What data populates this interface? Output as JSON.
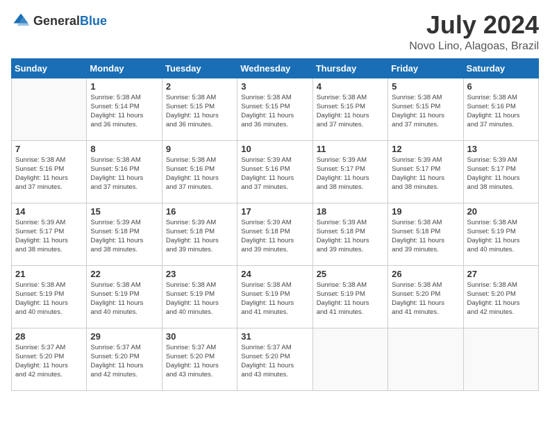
{
  "logo": {
    "general": "General",
    "blue": "Blue"
  },
  "title": "July 2024",
  "location": "Novo Lino, Alagoas, Brazil",
  "weekdays": [
    "Sunday",
    "Monday",
    "Tuesday",
    "Wednesday",
    "Thursday",
    "Friday",
    "Saturday"
  ],
  "weeks": [
    [
      {
        "day": "",
        "info": ""
      },
      {
        "day": "1",
        "info": "Sunrise: 5:38 AM\nSunset: 5:14 PM\nDaylight: 11 hours\nand 36 minutes."
      },
      {
        "day": "2",
        "info": "Sunrise: 5:38 AM\nSunset: 5:15 PM\nDaylight: 11 hours\nand 36 minutes."
      },
      {
        "day": "3",
        "info": "Sunrise: 5:38 AM\nSunset: 5:15 PM\nDaylight: 11 hours\nand 36 minutes."
      },
      {
        "day": "4",
        "info": "Sunrise: 5:38 AM\nSunset: 5:15 PM\nDaylight: 11 hours\nand 37 minutes."
      },
      {
        "day": "5",
        "info": "Sunrise: 5:38 AM\nSunset: 5:15 PM\nDaylight: 11 hours\nand 37 minutes."
      },
      {
        "day": "6",
        "info": "Sunrise: 5:38 AM\nSunset: 5:16 PM\nDaylight: 11 hours\nand 37 minutes."
      }
    ],
    [
      {
        "day": "7",
        "info": "Sunrise: 5:38 AM\nSunset: 5:16 PM\nDaylight: 11 hours\nand 37 minutes."
      },
      {
        "day": "8",
        "info": "Sunrise: 5:38 AM\nSunset: 5:16 PM\nDaylight: 11 hours\nand 37 minutes."
      },
      {
        "day": "9",
        "info": "Sunrise: 5:38 AM\nSunset: 5:16 PM\nDaylight: 11 hours\nand 37 minutes."
      },
      {
        "day": "10",
        "info": "Sunrise: 5:39 AM\nSunset: 5:16 PM\nDaylight: 11 hours\nand 37 minutes."
      },
      {
        "day": "11",
        "info": "Sunrise: 5:39 AM\nSunset: 5:17 PM\nDaylight: 11 hours\nand 38 minutes."
      },
      {
        "day": "12",
        "info": "Sunrise: 5:39 AM\nSunset: 5:17 PM\nDaylight: 11 hours\nand 38 minutes."
      },
      {
        "day": "13",
        "info": "Sunrise: 5:39 AM\nSunset: 5:17 PM\nDaylight: 11 hours\nand 38 minutes."
      }
    ],
    [
      {
        "day": "14",
        "info": "Sunrise: 5:39 AM\nSunset: 5:17 PM\nDaylight: 11 hours\nand 38 minutes."
      },
      {
        "day": "15",
        "info": "Sunrise: 5:39 AM\nSunset: 5:18 PM\nDaylight: 11 hours\nand 38 minutes."
      },
      {
        "day": "16",
        "info": "Sunrise: 5:39 AM\nSunset: 5:18 PM\nDaylight: 11 hours\nand 39 minutes."
      },
      {
        "day": "17",
        "info": "Sunrise: 5:39 AM\nSunset: 5:18 PM\nDaylight: 11 hours\nand 39 minutes."
      },
      {
        "day": "18",
        "info": "Sunrise: 5:39 AM\nSunset: 5:18 PM\nDaylight: 11 hours\nand 39 minutes."
      },
      {
        "day": "19",
        "info": "Sunrise: 5:38 AM\nSunset: 5:18 PM\nDaylight: 11 hours\nand 39 minutes."
      },
      {
        "day": "20",
        "info": "Sunrise: 5:38 AM\nSunset: 5:19 PM\nDaylight: 11 hours\nand 40 minutes."
      }
    ],
    [
      {
        "day": "21",
        "info": "Sunrise: 5:38 AM\nSunset: 5:19 PM\nDaylight: 11 hours\nand 40 minutes."
      },
      {
        "day": "22",
        "info": "Sunrise: 5:38 AM\nSunset: 5:19 PM\nDaylight: 11 hours\nand 40 minutes."
      },
      {
        "day": "23",
        "info": "Sunrise: 5:38 AM\nSunset: 5:19 PM\nDaylight: 11 hours\nand 40 minutes."
      },
      {
        "day": "24",
        "info": "Sunrise: 5:38 AM\nSunset: 5:19 PM\nDaylight: 11 hours\nand 41 minutes."
      },
      {
        "day": "25",
        "info": "Sunrise: 5:38 AM\nSunset: 5:19 PM\nDaylight: 11 hours\nand 41 minutes."
      },
      {
        "day": "26",
        "info": "Sunrise: 5:38 AM\nSunset: 5:20 PM\nDaylight: 11 hours\nand 41 minutes."
      },
      {
        "day": "27",
        "info": "Sunrise: 5:38 AM\nSunset: 5:20 PM\nDaylight: 11 hours\nand 42 minutes."
      }
    ],
    [
      {
        "day": "28",
        "info": "Sunrise: 5:37 AM\nSunset: 5:20 PM\nDaylight: 11 hours\nand 42 minutes."
      },
      {
        "day": "29",
        "info": "Sunrise: 5:37 AM\nSunset: 5:20 PM\nDaylight: 11 hours\nand 42 minutes."
      },
      {
        "day": "30",
        "info": "Sunrise: 5:37 AM\nSunset: 5:20 PM\nDaylight: 11 hours\nand 43 minutes."
      },
      {
        "day": "31",
        "info": "Sunrise: 5:37 AM\nSunset: 5:20 PM\nDaylight: 11 hours\nand 43 minutes."
      },
      {
        "day": "",
        "info": ""
      },
      {
        "day": "",
        "info": ""
      },
      {
        "day": "",
        "info": ""
      }
    ]
  ]
}
